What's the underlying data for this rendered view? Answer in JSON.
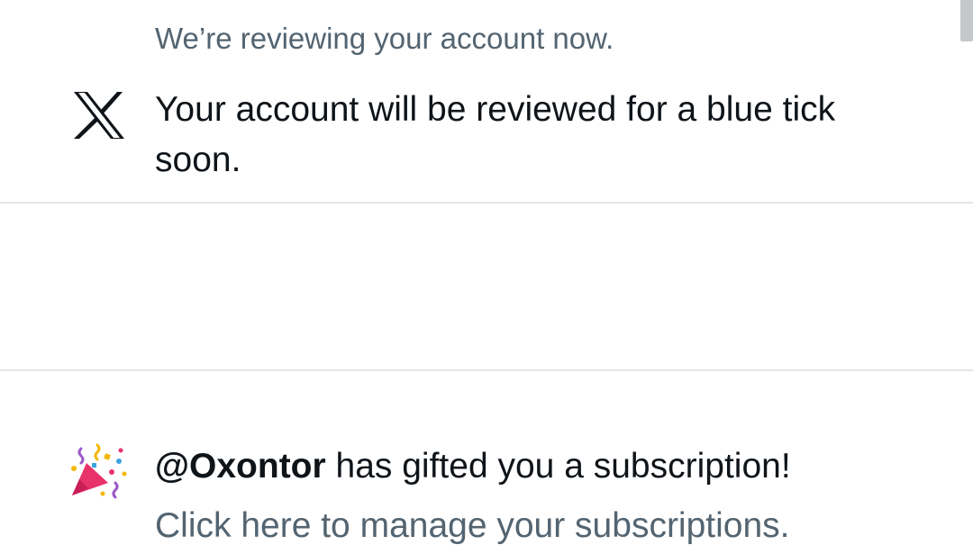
{
  "notifications": [
    {
      "icon": "x-logo-icon",
      "context_text": "We’re reviewing your account now.",
      "main_text": "Your account will be reviewed for a blue tick soon."
    },
    {
      "icon": "party-popper-icon",
      "handle": "@Oxontor",
      "main_text_suffix": " has gifted you a subscription!",
      "link_text": "Click here to manage your subscriptions."
    }
  ],
  "colors": {
    "primary_text": "#0f1419",
    "secondary_text": "#536471",
    "divider": "#e3e6e8",
    "party_cone": "#e8326a"
  }
}
